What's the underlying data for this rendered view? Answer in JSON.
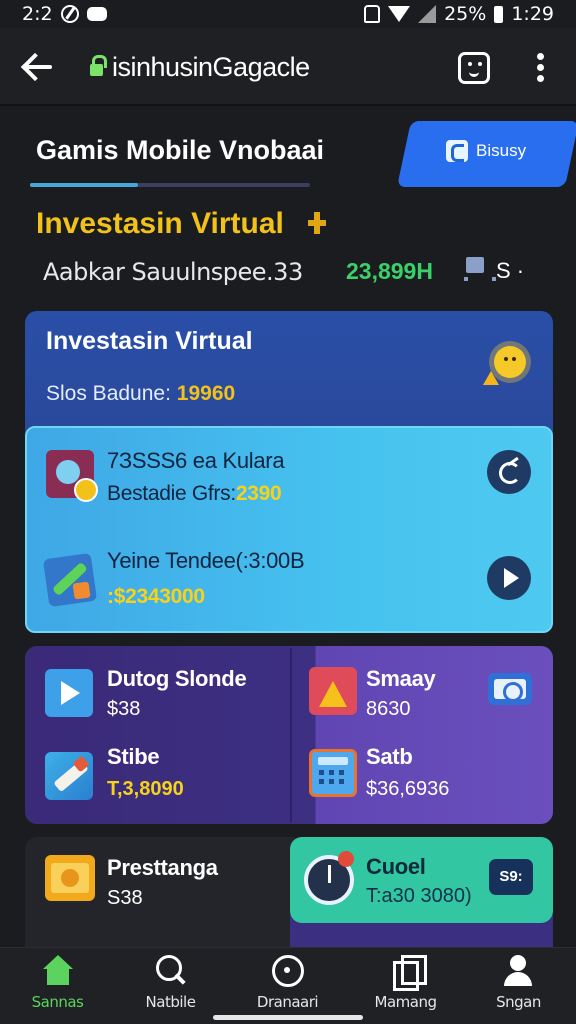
{
  "status_bar": {
    "time_left": "2:2",
    "battery": "25%",
    "time_right": "1:29"
  },
  "browser": {
    "url": "isinhusinGagacle"
  },
  "header": {
    "tab_title": "Gamis  Mobile Vnobaai",
    "bisnis_button": "Bisusy",
    "section_title": "Investasin Virtual",
    "summary_label": "Aabkar Sauulnspee.33",
    "summary_value": "23,899H",
    "cart_label": "S ·"
  },
  "virtual_card": {
    "title": "Investasin Virtual",
    "balance_label": "Slos Badune:",
    "balance_value": "19960",
    "rows": [
      {
        "title": "7ЗSSS6 ea Kulara",
        "sub_label": "Bestadie Gfrs:",
        "sub_value": "2390"
      },
      {
        "title": "Yeine Tendee(:3:00B",
        "sub_label": ":$2343000"
      }
    ]
  },
  "tiles": [
    {
      "title": "Dutog Slonde",
      "sub": "$38"
    },
    {
      "title": "Smaay",
      "sub": "8630"
    },
    {
      "title": "Stibe",
      "sub": "T,3,8090"
    },
    {
      "title": "Satb",
      "sub": "$36,6936"
    }
  ],
  "bottom_cards": {
    "left": {
      "title": "Presttanga",
      "sub": "S38"
    },
    "right": {
      "title": "Cuoel",
      "sub": "T:a30 3080)",
      "button": "S9:"
    }
  },
  "bottom_nav": [
    {
      "label": "Sannas",
      "icon": "home-icon",
      "active": true
    },
    {
      "label": "Natbile",
      "icon": "search-icon"
    },
    {
      "label": "Dranaari",
      "icon": "disc-icon"
    },
    {
      "label": "Mamang",
      "icon": "pages-icon"
    },
    {
      "label": "Sngan",
      "icon": "user-icon"
    }
  ],
  "colors": {
    "accent_gold": "#f2c21b",
    "accent_green": "#3bd16a",
    "card_blue": "#2a4fa8",
    "inner_cyan": "#46c2ef",
    "card_purple": "#3d2f82",
    "card_teal": "#32c6a2",
    "button_blue": "#2a6ef0"
  }
}
